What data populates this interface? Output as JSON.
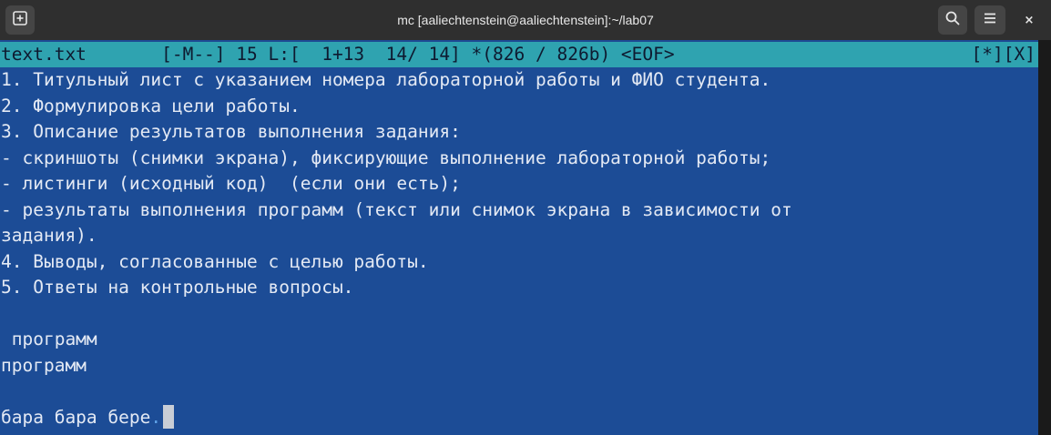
{
  "window": {
    "title": "mc [aaliechtenstein@aaliechtenstein]:~/lab07",
    "buttons": {
      "new_tab_icon": "new-tab-icon",
      "search_icon": "search-icon",
      "menu_icon": "hamburger-menu-icon",
      "close_glyph": "×"
    }
  },
  "editor": {
    "status_left": "text.txt       [-M--] 15 L:[  1+13  14/ 14] *(826 / 826b) <EOF>",
    "status_right": "[*][X]",
    "lines": [
      "1. Титульный лист с указанием номера лабораторной работы и ФИО студента.",
      "2. Формулировка цели работы.",
      "3. Описание результатов выполнения задания:",
      "- скриншоты (снимки экрана), фиксирующие выполнение лабораторной работы;",
      "- листинги (исходный код)  (если они есть);",
      "- результаты выполнения программ (текст или снимок экрана в зависимости от",
      "задания).",
      "4. Выводы, согласованные с целью работы.",
      "5. Ответы на контрольные вопросы.",
      "",
      " программ",
      "программ",
      "",
      "бара бара бере"
    ],
    "last_line_eol_mark": ".",
    "colors": {
      "background": "#1c4c96",
      "status_bar": "#2fa3b0",
      "text": "#e3e9f4"
    }
  }
}
